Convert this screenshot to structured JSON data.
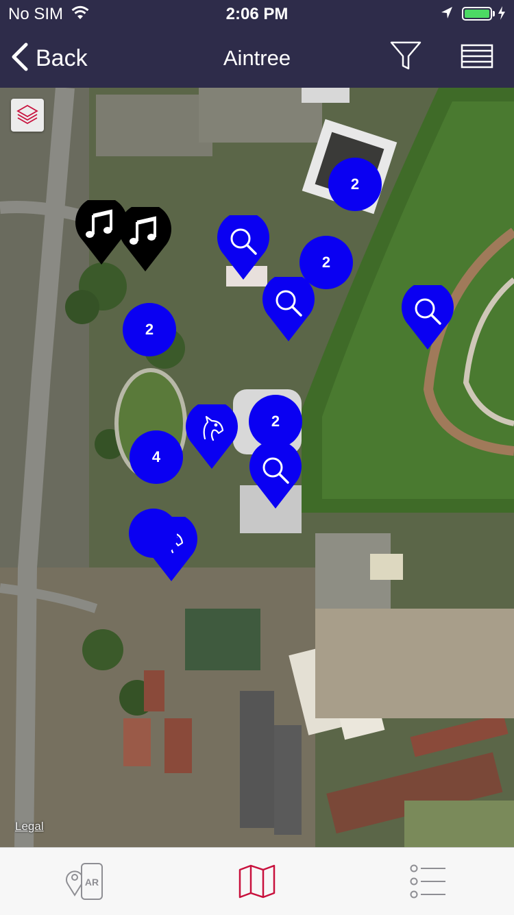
{
  "status_bar": {
    "carrier": "No SIM",
    "time": "2:06 PM",
    "wifi_icon": "wifi-icon",
    "location_icon": "location-arrow-icon",
    "battery_icon": "battery-charging-icon",
    "battery_level": 1.0,
    "battery_color": "#4cd964"
  },
  "nav": {
    "back_label": "Back",
    "title": "Aintree",
    "back_icon": "chevron-left-icon",
    "filter_icon": "filter-icon",
    "menu_icon": "list-menu-icon",
    "background_color": "#2e2c4a"
  },
  "map": {
    "layers_icon": "layers-icon",
    "legal_label": "Legal",
    "marker_color": "#0a00f2",
    "music_marker_color": "#000000",
    "clusters": [
      {
        "count": "2"
      },
      {
        "count": "2"
      },
      {
        "count": "2"
      },
      {
        "count": "2"
      },
      {
        "count": "4"
      }
    ],
    "markers": [
      {
        "type": "music",
        "icon": "music-note-icon"
      },
      {
        "type": "music",
        "icon": "music-note-icon"
      },
      {
        "type": "search",
        "icon": "magnifier-icon"
      },
      {
        "type": "search",
        "icon": "magnifier-icon"
      },
      {
        "type": "search",
        "icon": "magnifier-icon"
      },
      {
        "type": "search",
        "icon": "magnifier-icon"
      },
      {
        "type": "horse",
        "icon": "horse-head-icon"
      },
      {
        "type": "horse",
        "icon": "horse-head-icon"
      }
    ]
  },
  "tab_bar": {
    "tabs": [
      {
        "name": "ar",
        "icon": "ar-location-icon",
        "label": "AR",
        "active": false
      },
      {
        "name": "map",
        "icon": "map-icon",
        "active": true
      },
      {
        "name": "list",
        "icon": "list-icon",
        "active": false
      }
    ],
    "active_color": "#c8103c",
    "inactive_color": "#8e8e93"
  }
}
